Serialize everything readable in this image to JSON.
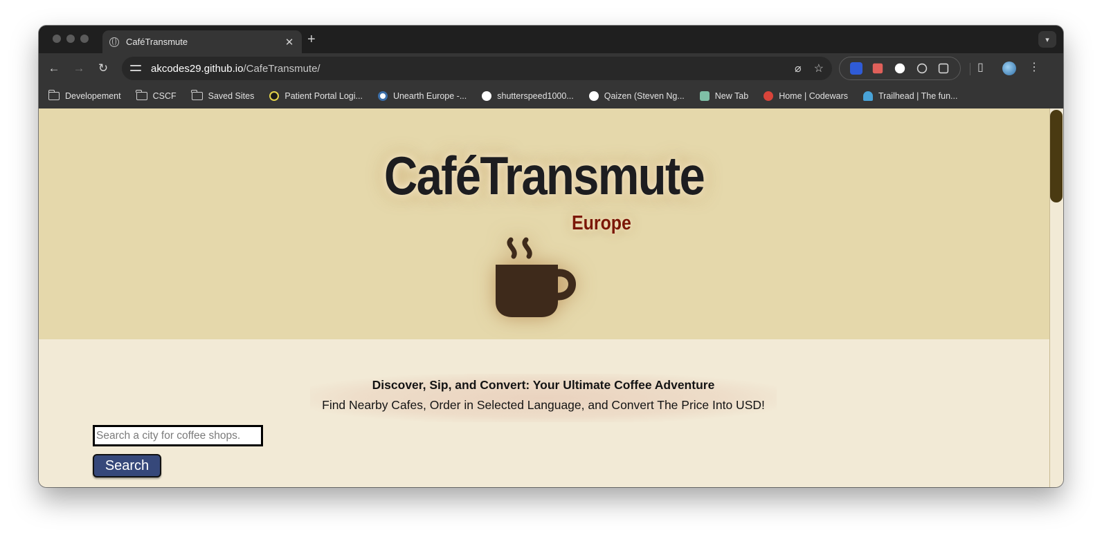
{
  "browser": {
    "tab": {
      "title": "CaféTransmute"
    },
    "address": {
      "host": "akcodes29.github.io",
      "path": "/CafeTransmute/"
    },
    "bookmarks": [
      {
        "label": "Developement",
        "icon": "folder-icon"
      },
      {
        "label": "CSCF",
        "icon": "folder-icon"
      },
      {
        "label": "Saved Sites",
        "icon": "folder-icon"
      },
      {
        "label": "Patient Portal Logi...",
        "icon": "patient-portal-icon"
      },
      {
        "label": "Unearth Europe -...",
        "icon": "wordpress-icon"
      },
      {
        "label": "shutterspeed1000...",
        "icon": "github-icon"
      },
      {
        "label": "Qaizen (Steven Ng...",
        "icon": "github-icon"
      },
      {
        "label": "New Tab",
        "icon": "new-tab-icon"
      },
      {
        "label": "Home | Codewars",
        "icon": "codewars-icon"
      },
      {
        "label": "Trailhead | The fun...",
        "icon": "trailhead-icon"
      }
    ]
  },
  "page": {
    "title": "CaféTransmute",
    "subtitle": "Europe",
    "hero_icon": "coffee-cup-icon",
    "tagline_bold": "Discover, Sip, and Convert: Your Ultimate Coffee Adventure",
    "tagline": "Find Nearby Cafes, Order in Selected Language, and Convert The Price Into USD!",
    "search": {
      "placeholder": "Search a city for coffee shops.",
      "value": "",
      "button_label": "Search"
    }
  },
  "colors": {
    "hero_bg": "#e5d8ab",
    "page_bg": "#f2ead6",
    "title": "#1d1d20",
    "subtitle": "#7b1707",
    "cup": "#3e2a1b",
    "button_bg": "#36487a",
    "scrollbar_thumb": "#4a3a12"
  }
}
